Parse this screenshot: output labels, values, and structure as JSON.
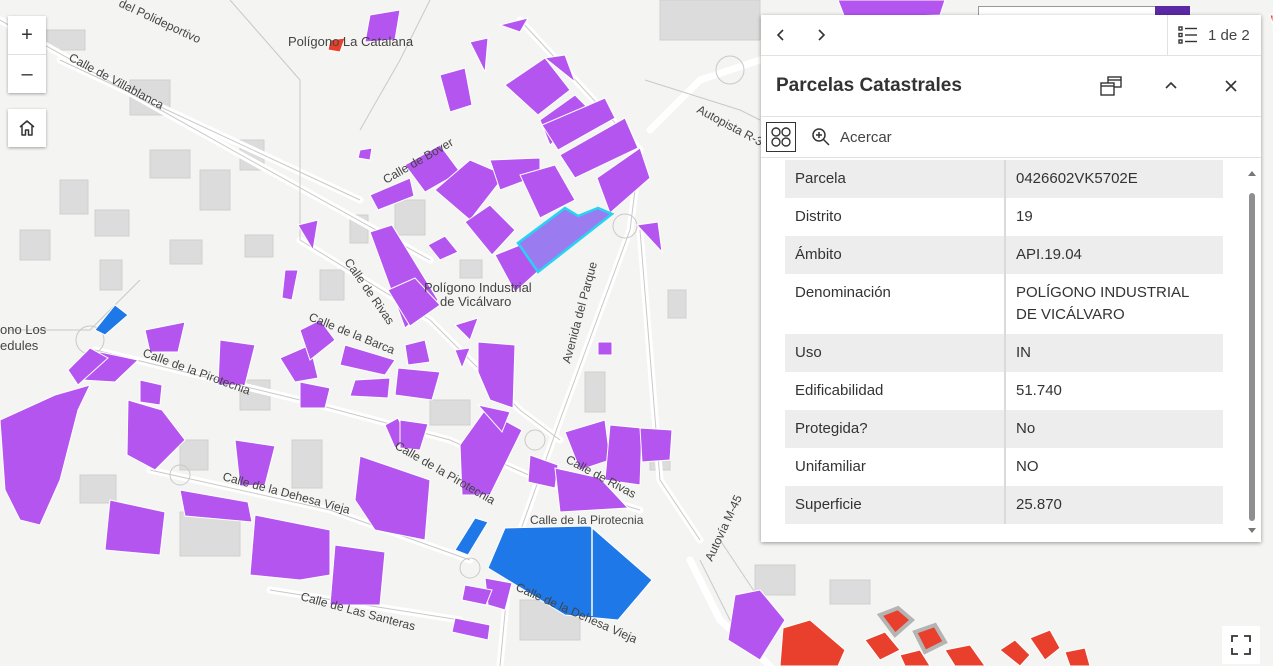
{
  "map": {
    "labels": {
      "polideportivo": "del Polideportivo",
      "villablanca": "Calle de Villablanca",
      "catalana": "Polígono La Catalana",
      "bover": "Calle de Bover",
      "autopista": "Autopista R-3",
      "rivas_1": "Calle de Rivas",
      "rivas_2": "Calle de Rivas",
      "industrial_1": "Polígono  Industrial",
      "industrial_2": "de Vicálvaro",
      "barca": "Calle de la Barca",
      "parque": "Avenida del Parque",
      "los_1": "ono  Los",
      "los_2": "edules",
      "pirotecnia_1": "Calle de la Pirotecnia",
      "pirotecnia_2": "Calle de la Pirotecnia",
      "pirotecnia_3": "Calle de la Pirotecnia",
      "dehesa_1": "Calle de la Dehesa Vieja",
      "dehesa_2": "Calle de la Dehesa Vieja",
      "m45": "Autovía M-45",
      "santeras": "Calle de Las Santeras"
    },
    "colors": {
      "parcel": "#b455f0",
      "parcel_blue": "#1e78e8",
      "selected_fill": "#9b7cf0",
      "selected_outline": "#27d3f2",
      "red_block": "#e8402c",
      "background": "#f4f4f2"
    }
  },
  "controls": {
    "zoom_in": "+",
    "zoom_out": "–",
    "home_icon": "home-icon",
    "fullscreen_icon": "fullscreen-icon"
  },
  "popup": {
    "title": "Parcelas Catastrales",
    "feature_count": "1 de 2",
    "zoom_label": "Acercar",
    "rows": [
      {
        "key": "Parcela",
        "value": "0426602VK5702E"
      },
      {
        "key": "Distrito",
        "value": "19"
      },
      {
        "key": "Ámbito",
        "value": "API.19.04"
      },
      {
        "key": "Denominación",
        "value": "POLÍGONO INDUSTRIAL DE VICÁLVARO"
      },
      {
        "key": "Uso",
        "value": "IN"
      },
      {
        "key": "Edificabilidad",
        "value": "51.740"
      },
      {
        "key": "Protegida?",
        "value": "No"
      },
      {
        "key": "Unifamiliar",
        "value": "NO"
      },
      {
        "key": "Superficie",
        "value": "25.870"
      }
    ]
  }
}
